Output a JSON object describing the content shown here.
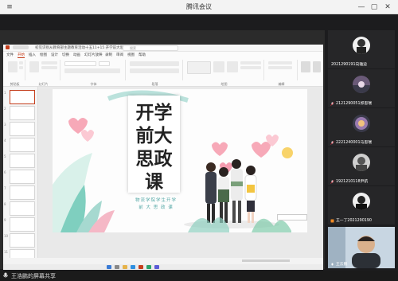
{
  "window": {
    "title": "腾讯会议"
  },
  "ppt": {
    "doc_title": "初见识别从教育部主题教育活动十五11+15 开学前大思政课件",
    "search_placeholder": "搜索",
    "tabs": [
      "文件",
      "开始",
      "插入",
      "绘图",
      "设计",
      "切换",
      "动画",
      "幻灯片放映",
      "录制",
      "审阅",
      "视图",
      "帮助"
    ],
    "active_tab": "开始",
    "ribbon_groups": [
      "剪贴板",
      "幻灯片",
      "字体",
      "段落",
      "绘图",
      "编辑"
    ],
    "slide": {
      "heading_lines": [
        "开学",
        "前大",
        "思政",
        "课"
      ],
      "subtitle_lines": [
        "物流学院学生开学",
        "前 大 思 政 课"
      ]
    },
    "thumb_count": 11
  },
  "participants": [
    {
      "name": "2021290191向雅迪",
      "avatar_color": "#f2f2f2"
    },
    {
      "name": "2121290051郭思瑞",
      "avatar_color": "#6a5a78"
    },
    {
      "name": "2221240001马思瑞",
      "avatar_color": "#3a3a4a"
    },
    {
      "name": "1921210118尹航",
      "avatar_color": "#cfcfcf"
    },
    {
      "name": "王一丁2021290190",
      "avatar_color": "#efefef"
    },
    {
      "name": "王云鹏",
      "avatar_color": "#9eb7c9"
    }
  ],
  "footer": {
    "share_label": "王浩鹏的屏幕共享"
  }
}
